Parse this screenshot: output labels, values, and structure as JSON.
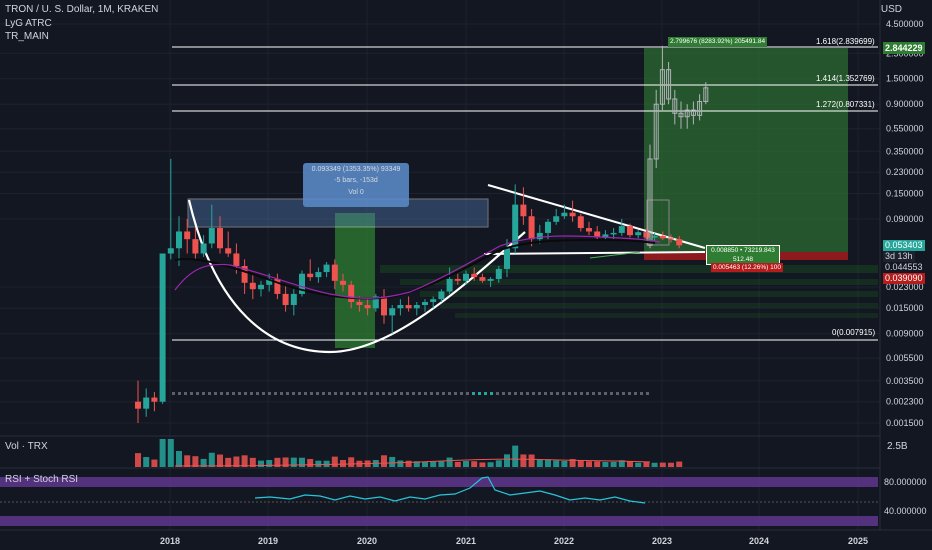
{
  "header": {
    "symbol": "TRON / U. S. Dollar, 1M, KRAKEN",
    "indicator1": "LyG ATRC",
    "indicator2": "TR_MAIN"
  },
  "currency": "USD",
  "colors": {
    "background": "#131722",
    "up": "#26a69a",
    "down": "#ef5350",
    "profit_zone": "#2e7d32",
    "loss_zone": "#b71c1c",
    "rsi_band": "#6a3b9b",
    "line": "#ffffff"
  },
  "price_axis": [
    "4.500000",
    "2.500000",
    "1.500000",
    "0.900000",
    "0.550000",
    "0.350000",
    "0.230000",
    "0.150000",
    "0.090000",
    "0.023000",
    "0.015000",
    "0.009000",
    "0.005500",
    "0.003500",
    "0.002300",
    "0.001500"
  ],
  "price_tags": {
    "target": "2.844229",
    "last": "0.053403",
    "countdown": "3d 13h",
    "low_a": "0.044553",
    "low_b": "0.039090"
  },
  "fib_labels": {
    "f1618": "1.618(2.839699)",
    "f1414": "1.414(1.352769)",
    "f1272": "1.272(0.807331)",
    "f0": "0(0.007915)"
  },
  "measure_box": {
    "line1": "0.093349 (1353.35%) 93349",
    "line2": "-5 bars, -153d",
    "line3": "Vol 0"
  },
  "position_labels": {
    "target": "2.799676 (8283.92%) 205491.84",
    "entry1": "0.008850 • 73219.843",
    "entry2": "512.48",
    "stop": "0.005463 (12.26%) 100"
  },
  "volume_pane": {
    "label": "Vol · TRX",
    "scale": "2.5B"
  },
  "rsi_pane": {
    "label": "RSI + Stoch RSI",
    "upper": "80.000000",
    "lower": "40.000000"
  },
  "x_axis": [
    "2018",
    "2019",
    "2020",
    "2021",
    "2022",
    "2023",
    "2024",
    "2025"
  ],
  "chart_data": {
    "type": "candlestick",
    "symbol": "TRXUSD",
    "interval": "1M",
    "y_scale": "log",
    "candles": [
      {
        "o": 0.0023,
        "h": 0.0035,
        "l": 0.0015,
        "c": 0.002
      },
      {
        "o": 0.002,
        "h": 0.003,
        "l": 0.0017,
        "c": 0.0025
      },
      {
        "o": 0.0025,
        "h": 0.0028,
        "l": 0.0019,
        "c": 0.0023
      },
      {
        "o": 0.0023,
        "h": 0.045,
        "l": 0.0022,
        "c": 0.045
      },
      {
        "o": 0.045,
        "h": 0.3,
        "l": 0.04,
        "c": 0.05
      },
      {
        "o": 0.05,
        "h": 0.095,
        "l": 0.035,
        "c": 0.07
      },
      {
        "o": 0.07,
        "h": 0.09,
        "l": 0.045,
        "c": 0.06
      },
      {
        "o": 0.06,
        "h": 0.075,
        "l": 0.04,
        "c": 0.045
      },
      {
        "o": 0.045,
        "h": 0.065,
        "l": 0.042,
        "c": 0.055
      },
      {
        "o": 0.055,
        "h": 0.12,
        "l": 0.05,
        "c": 0.075
      },
      {
        "o": 0.075,
        "h": 0.095,
        "l": 0.045,
        "c": 0.05
      },
      {
        "o": 0.05,
        "h": 0.07,
        "l": 0.042,
        "c": 0.045
      },
      {
        "o": 0.045,
        "h": 0.055,
        "l": 0.03,
        "c": 0.035
      },
      {
        "o": 0.035,
        "h": 0.04,
        "l": 0.02,
        "c": 0.025
      },
      {
        "o": 0.025,
        "h": 0.03,
        "l": 0.018,
        "c": 0.022
      },
      {
        "o": 0.022,
        "h": 0.026,
        "l": 0.019,
        "c": 0.024
      },
      {
        "o": 0.024,
        "h": 0.03,
        "l": 0.021,
        "c": 0.027
      },
      {
        "o": 0.027,
        "h": 0.03,
        "l": 0.018,
        "c": 0.02
      },
      {
        "o": 0.02,
        "h": 0.024,
        "l": 0.014,
        "c": 0.016
      },
      {
        "o": 0.016,
        "h": 0.022,
        "l": 0.013,
        "c": 0.02
      },
      {
        "o": 0.02,
        "h": 0.032,
        "l": 0.019,
        "c": 0.03
      },
      {
        "o": 0.03,
        "h": 0.04,
        "l": 0.026,
        "c": 0.028
      },
      {
        "o": 0.028,
        "h": 0.034,
        "l": 0.025,
        "c": 0.031
      },
      {
        "o": 0.031,
        "h": 0.038,
        "l": 0.028,
        "c": 0.036
      },
      {
        "o": 0.036,
        "h": 0.04,
        "l": 0.022,
        "c": 0.026
      },
      {
        "o": 0.026,
        "h": 0.03,
        "l": 0.021,
        "c": 0.024
      },
      {
        "o": 0.024,
        "h": 0.026,
        "l": 0.015,
        "c": 0.017
      },
      {
        "o": 0.017,
        "h": 0.019,
        "l": 0.014,
        "c": 0.016
      },
      {
        "o": 0.016,
        "h": 0.018,
        "l": 0.013,
        "c": 0.015
      },
      {
        "o": 0.015,
        "h": 0.02,
        "l": 0.014,
        "c": 0.019
      },
      {
        "o": 0.019,
        "h": 0.022,
        "l": 0.011,
        "c": 0.013
      },
      {
        "o": 0.013,
        "h": 0.016,
        "l": 0.009,
        "c": 0.015
      },
      {
        "o": 0.015,
        "h": 0.018,
        "l": 0.013,
        "c": 0.016
      },
      {
        "o": 0.016,
        "h": 0.019,
        "l": 0.014,
        "c": 0.015
      },
      {
        "o": 0.015,
        "h": 0.017,
        "l": 0.013,
        "c": 0.016
      },
      {
        "o": 0.016,
        "h": 0.018,
        "l": 0.014,
        "c": 0.017
      },
      {
        "o": 0.017,
        "h": 0.019,
        "l": 0.015,
        "c": 0.018
      },
      {
        "o": 0.018,
        "h": 0.022,
        "l": 0.017,
        "c": 0.021
      },
      {
        "o": 0.021,
        "h": 0.034,
        "l": 0.02,
        "c": 0.027
      },
      {
        "o": 0.027,
        "h": 0.03,
        "l": 0.024,
        "c": 0.026
      },
      {
        "o": 0.026,
        "h": 0.032,
        "l": 0.024,
        "c": 0.03
      },
      {
        "o": 0.03,
        "h": 0.034,
        "l": 0.026,
        "c": 0.028
      },
      {
        "o": 0.028,
        "h": 0.03,
        "l": 0.025,
        "c": 0.026
      },
      {
        "o": 0.026,
        "h": 0.028,
        "l": 0.023,
        "c": 0.027
      },
      {
        "o": 0.027,
        "h": 0.035,
        "l": 0.025,
        "c": 0.033
      },
      {
        "o": 0.033,
        "h": 0.06,
        "l": 0.028,
        "c": 0.05
      },
      {
        "o": 0.05,
        "h": 0.18,
        "l": 0.045,
        "c": 0.12
      },
      {
        "o": 0.12,
        "h": 0.17,
        "l": 0.08,
        "c": 0.095
      },
      {
        "o": 0.095,
        "h": 0.11,
        "l": 0.052,
        "c": 0.06
      },
      {
        "o": 0.06,
        "h": 0.08,
        "l": 0.055,
        "c": 0.068
      },
      {
        "o": 0.068,
        "h": 0.09,
        "l": 0.06,
        "c": 0.085
      },
      {
        "o": 0.085,
        "h": 0.11,
        "l": 0.08,
        "c": 0.095
      },
      {
        "o": 0.095,
        "h": 0.12,
        "l": 0.09,
        "c": 0.102
      },
      {
        "o": 0.102,
        "h": 0.13,
        "l": 0.085,
        "c": 0.095
      },
      {
        "o": 0.095,
        "h": 0.1,
        "l": 0.07,
        "c": 0.075
      },
      {
        "o": 0.075,
        "h": 0.085,
        "l": 0.065,
        "c": 0.07
      },
      {
        "o": 0.07,
        "h": 0.078,
        "l": 0.06,
        "c": 0.062
      },
      {
        "o": 0.062,
        "h": 0.072,
        "l": 0.058,
        "c": 0.066
      },
      {
        "o": 0.066,
        "h": 0.075,
        "l": 0.06,
        "c": 0.068
      },
      {
        "o": 0.068,
        "h": 0.09,
        "l": 0.064,
        "c": 0.078
      },
      {
        "o": 0.078,
        "h": 0.082,
        "l": 0.062,
        "c": 0.065
      },
      {
        "o": 0.065,
        "h": 0.072,
        "l": 0.061,
        "c": 0.069
      },
      {
        "o": 0.069,
        "h": 0.074,
        "l": 0.06,
        "c": 0.062
      },
      {
        "o": 0.062,
        "h": 0.068,
        "l": 0.058,
        "c": 0.064
      },
      {
        "o": 0.064,
        "h": 0.07,
        "l": 0.059,
        "c": 0.061
      },
      {
        "o": 0.061,
        "h": 0.066,
        "l": 0.056,
        "c": 0.06
      },
      {
        "o": 0.06,
        "h": 0.064,
        "l": 0.05,
        "c": 0.053
      }
    ],
    "projection": [
      {
        "o": 0.053,
        "h": 0.4,
        "l": 0.05,
        "c": 0.3
      },
      {
        "o": 0.3,
        "h": 1.2,
        "l": 0.25,
        "c": 0.9
      },
      {
        "o": 0.9,
        "h": 2.9,
        "l": 0.8,
        "c": 1.8
      },
      {
        "o": 1.8,
        "h": 2.1,
        "l": 0.9,
        "c": 1.0
      },
      {
        "o": 1.0,
        "h": 1.2,
        "l": 0.6,
        "c": 0.75
      },
      {
        "o": 0.75,
        "h": 0.95,
        "l": 0.55,
        "c": 0.7
      },
      {
        "o": 0.7,
        "h": 0.9,
        "l": 0.55,
        "c": 0.8
      },
      {
        "o": 0.8,
        "h": 0.95,
        "l": 0.6,
        "c": 0.72
      },
      {
        "o": 0.72,
        "h": 1.1,
        "l": 0.65,
        "c": 0.95
      },
      {
        "o": 0.95,
        "h": 1.4,
        "l": 0.9,
        "c": 1.25
      }
    ],
    "fib_levels": [
      {
        "label": "1.618",
        "price": 2.839699
      },
      {
        "label": "1.414",
        "price": 1.352769
      },
      {
        "label": "1.272",
        "price": 0.807331
      },
      {
        "label": "0",
        "price": 0.007915
      }
    ]
  }
}
